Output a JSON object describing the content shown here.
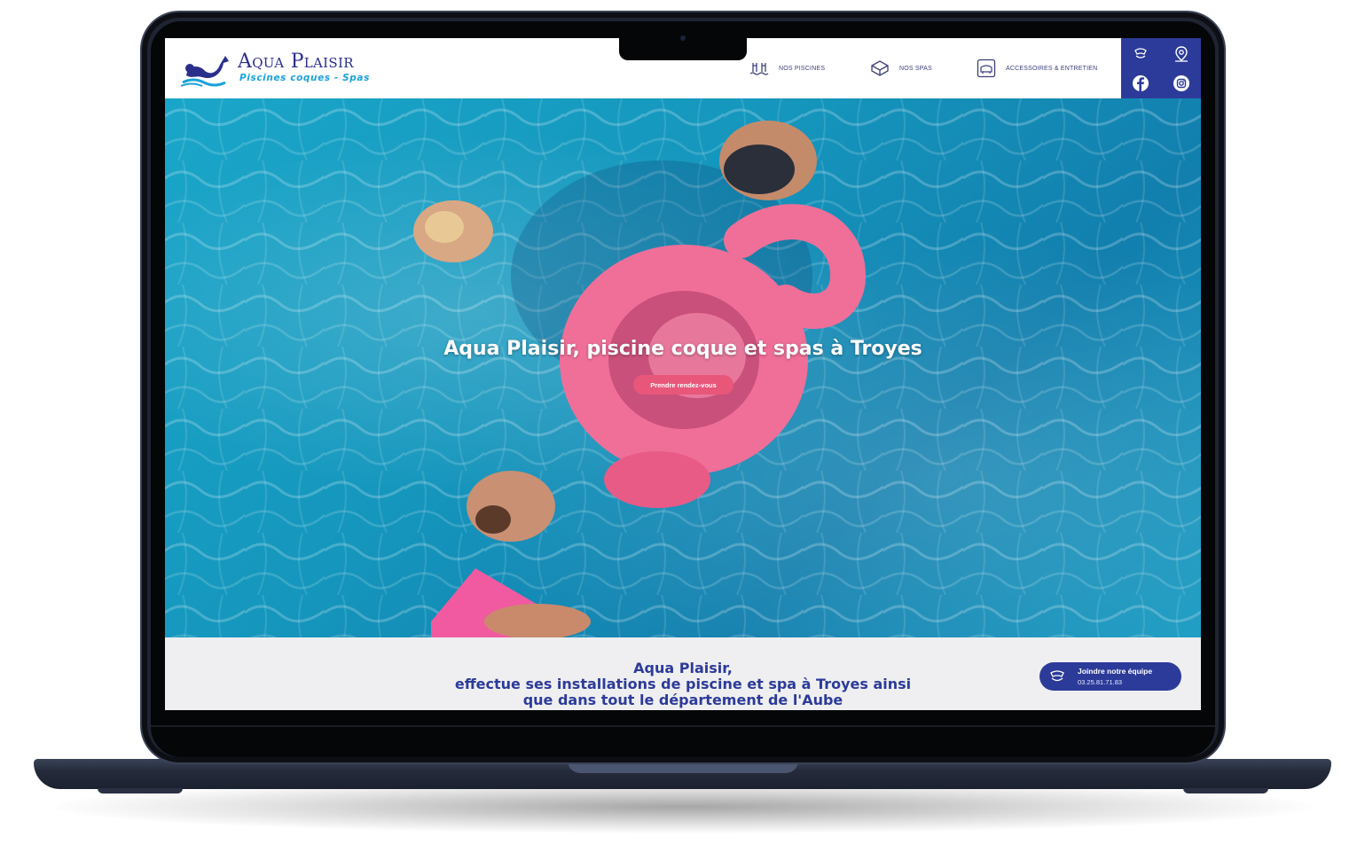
{
  "site": {
    "logo_title": "Aqua Plaisir",
    "logo_tagline": "Piscines coques - Spas"
  },
  "nav": {
    "items": [
      {
        "label": "NOS PISCINES",
        "icon": "pool-icon"
      },
      {
        "label": "NOS SPAS",
        "icon": "spa-icon"
      },
      {
        "label": "ACCESSOIRES & ENTRETIEN",
        "icon": "accessories-icon"
      }
    ]
  },
  "social": {
    "icons": [
      "phone-icon",
      "location-icon",
      "facebook-icon",
      "instagram-icon"
    ]
  },
  "hero": {
    "title": "Aqua Plaisir, piscine coque et spas à Troyes",
    "button_label": "Prendre rendez-vous"
  },
  "band": {
    "line1": "Aqua Plaisir,",
    "line2": "effectue ses installations de piscine et spa à Troyes ainsi",
    "line3": "que dans tout le département de l'Aube"
  },
  "cta": {
    "title": "Joindre notre équipe",
    "phone": "03.25.81.71.83"
  },
  "colors": {
    "brand_blue": "#2c3b99",
    "accent_pink": "#e8577a",
    "water": "#1596bd"
  }
}
